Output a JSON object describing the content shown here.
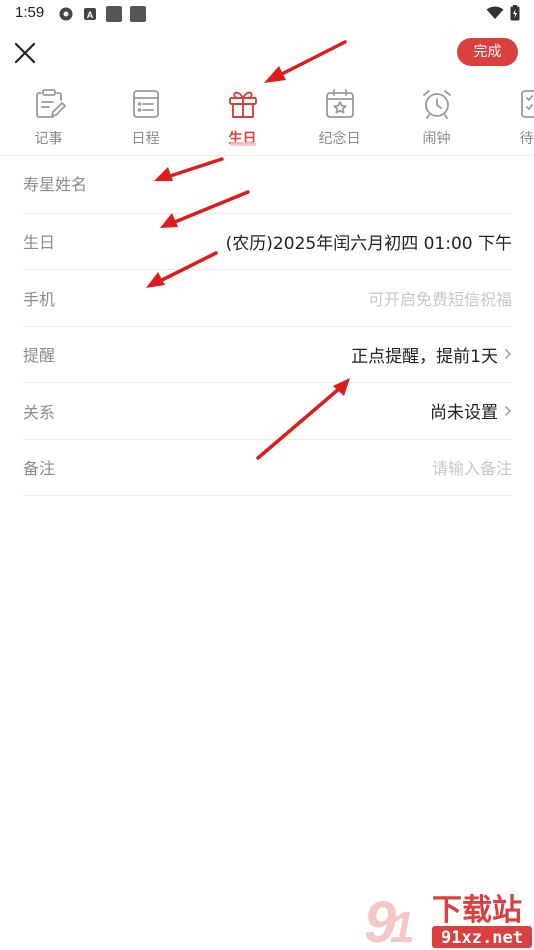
{
  "status_bar": {
    "time": "1:59",
    "icons": [
      "gear-icon",
      "a-icon",
      "square-icon",
      "square-icon",
      "wifi-icon",
      "battery-icon"
    ]
  },
  "topbar": {
    "close_icon": "close-icon",
    "done_label": "完成"
  },
  "tabs": [
    {
      "label": "记事",
      "icon": "note-icon",
      "active": false
    },
    {
      "label": "日程",
      "icon": "schedule-icon",
      "active": false
    },
    {
      "label": "生日",
      "icon": "gift-icon",
      "active": true
    },
    {
      "label": "纪念日",
      "icon": "calendar-star-icon",
      "active": false
    },
    {
      "label": "闹钟",
      "icon": "alarm-icon",
      "active": false
    },
    {
      "label": "待办",
      "icon": "todo-icon",
      "active": false
    }
  ],
  "form": {
    "name": {
      "placeholder": "寿星姓名",
      "value": ""
    },
    "birthday": {
      "label": "生日",
      "value": "(农历)2025年闰六月初四 01:00 下午"
    },
    "phone": {
      "label": "手机",
      "placeholder": "可开启免费短信祝福"
    },
    "reminder": {
      "label": "提醒",
      "value": "正点提醒，提前1天"
    },
    "relation": {
      "label": "关系",
      "value": "尚未设置"
    },
    "note": {
      "label": "备注",
      "placeholder": "请输入备注"
    }
  },
  "colors": {
    "accent": "#d9403f",
    "annotation_arrow": "#e01b1b",
    "label_gray": "#8c8c8c"
  },
  "watermark": {
    "brand": "下载站",
    "site": "91xz.net"
  }
}
